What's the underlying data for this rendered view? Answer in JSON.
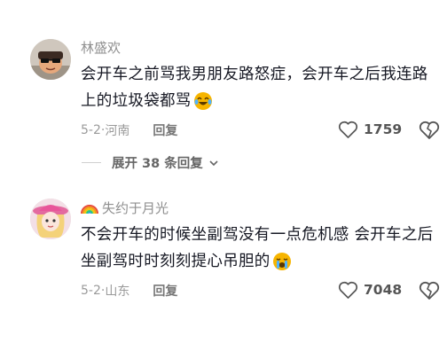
{
  "comments": [
    {
      "username": "林盛欢",
      "text": "会开车之前骂我男朋友路怒症，会开车之后我连路上的垃圾袋都骂",
      "emoji": "laugh-cry-emoji",
      "date": "5-2",
      "location": "河南",
      "reply_label": "回复",
      "likes": "1759"
    },
    {
      "username": "失约于月光",
      "username_prefix": "rainbow-icon",
      "text": "不会开车的时候坐副驾没有一点危机感 会开车之后坐副驾时时刻刻提心吊胆的",
      "emoji": "crying-emoji",
      "date": "5-2",
      "location": "山东",
      "reply_label": "回复",
      "likes": "7048"
    }
  ],
  "expand_replies": {
    "label": "展开 38 条回复"
  },
  "colors": {
    "text": "#161823",
    "muted": "#9a9a9a",
    "emoji": "#f7b500"
  }
}
